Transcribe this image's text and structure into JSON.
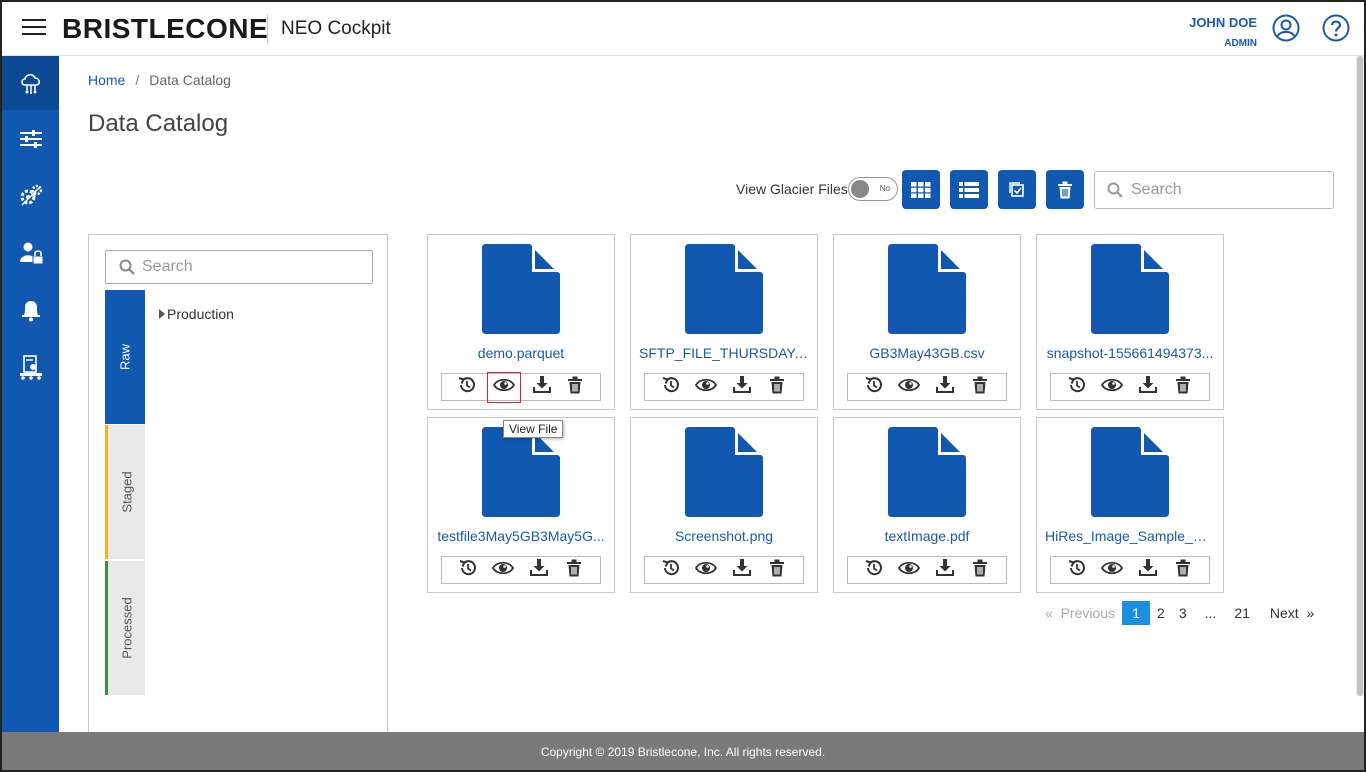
{
  "header": {
    "logo": "BRISTLECONE",
    "app_title": "NEO Cockpit",
    "user_name": "JOHN DOE",
    "user_role": "ADMIN"
  },
  "sidebar": {
    "items": [
      {
        "icon": "cloud-data-icon",
        "active": true
      },
      {
        "icon": "pipeline-icon",
        "active": false
      },
      {
        "icon": "gears-icon",
        "active": false
      },
      {
        "icon": "user-lock-icon",
        "active": false
      },
      {
        "icon": "bell-icon",
        "active": false
      },
      {
        "icon": "machine-icon",
        "active": false
      }
    ]
  },
  "breadcrumb": {
    "home": "Home",
    "separator": "/",
    "current": "Data Catalog"
  },
  "page_title": "Data Catalog",
  "toolbar": {
    "glacier_label": "View Glacier Files",
    "glacier_toggle": "No",
    "search_placeholder": "Search"
  },
  "left_panel": {
    "search_placeholder": "Search",
    "tabs": [
      "Raw",
      "Staged",
      "Processed"
    ],
    "tree": [
      "Production"
    ]
  },
  "files": [
    {
      "name": "demo.parquet"
    },
    {
      "name": "SFTP_FILE_THURSDAY.csv"
    },
    {
      "name": "GB3May43GB.csv"
    },
    {
      "name": "snapshot-155661494373..."
    },
    {
      "name": "testfile3May5GB3May5G..."
    },
    {
      "name": "Screenshot.png"
    },
    {
      "name": "textImage.pdf"
    },
    {
      "name": "HiRes_Image_Sample_PD..."
    }
  ],
  "tooltip": "View File",
  "pagination": {
    "previous": "Previous",
    "pages": [
      "1",
      "2",
      "3",
      "...",
      "21"
    ],
    "current": "1",
    "next": "Next",
    "prev_arrow": "«",
    "next_arrow": "»"
  },
  "footer": "Copyright © 2019 Bristlecone, Inc. All rights reserved.",
  "colors": {
    "primary": "#1158b0",
    "link": "#1c5aa8",
    "active_page": "#1a8fdd",
    "staged": "#f0b323",
    "processed": "#3e8e41"
  }
}
